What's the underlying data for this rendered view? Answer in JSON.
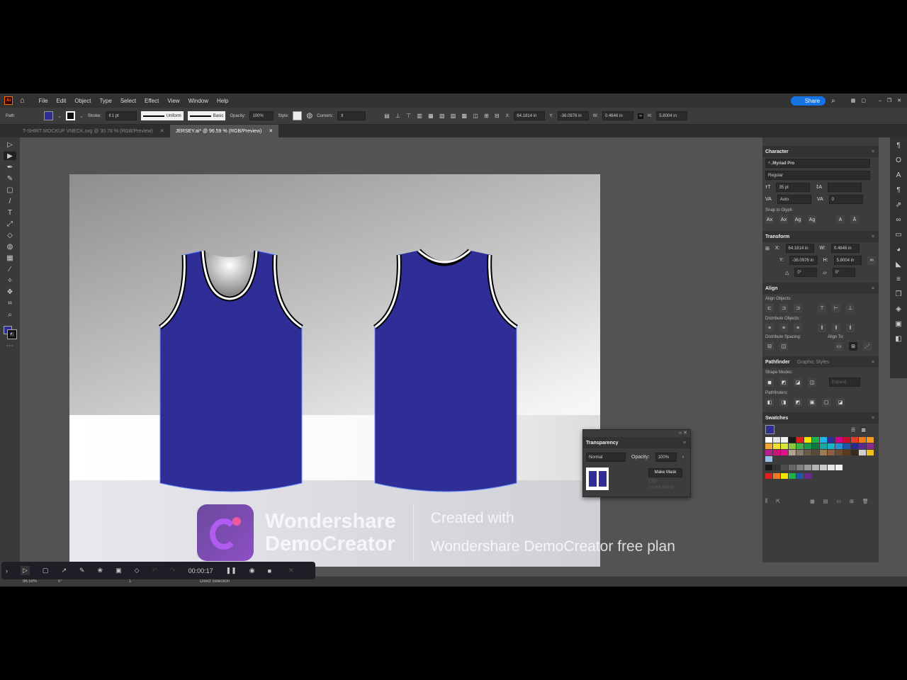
{
  "app": {
    "logo": "Ai",
    "title": "Adobe Illustrator"
  },
  "menu": [
    "File",
    "Edit",
    "Object",
    "Type",
    "Select",
    "Effect",
    "View",
    "Window",
    "Help"
  ],
  "topright": {
    "share_label": "Share"
  },
  "control": {
    "object_type": "Path",
    "fill_color": "#2e2e96",
    "stroke_label": "Stroke:",
    "stroke_weight": "1 pt",
    "profile": "Uniform",
    "brush": "Basic",
    "opacity_label": "Opacity:",
    "opacity": "100%",
    "style_label": "Style:",
    "corners_label": "Corners:",
    "x_label": "X:",
    "x": "64.1814 in",
    "y_label": "Y:",
    "y": "-36.0976 in",
    "w_label": "W:",
    "w": "0.4646 in",
    "h_label": "H:",
    "h": "5.8004 in"
  },
  "tabs": [
    {
      "label": "T-SHIRT MOCKUP VNECK.svg @ 30.78 % (RGB/Preview)",
      "active": false
    },
    {
      "label": "JERSEY.ai* @ 96.59 % (RGB/Preview)",
      "active": true
    }
  ],
  "tools": [
    "selection",
    "direct-selection",
    "pen",
    "curvature",
    "rectangle",
    "paintbrush",
    "type",
    "scale",
    "eraser",
    "shape-builder",
    "gradient",
    "eyedropper",
    "puppet-warp",
    "symbol-sprayer",
    "artboard",
    "zoom"
  ],
  "character": {
    "title": "Character",
    "font": "Myriad Pro",
    "style": "Regular",
    "size": "35 pt",
    "leading": "",
    "kerning": "Auto",
    "tracking": "0",
    "snap_label": "Snap to Glyph"
  },
  "transform": {
    "title": "Transform",
    "x": "64.1814 in",
    "y": "-36.0976 in",
    "w": "0.4646 in",
    "h": "5.8004 in",
    "rotate": "0°",
    "shear": "0°"
  },
  "align": {
    "title": "Align",
    "align_objects": "Align Objects:",
    "distribute_objects": "Distribute Objects:",
    "distribute_spacing": "Distribute Spacing:",
    "align_to": "Align To:"
  },
  "pathfinder": {
    "title": "Pathfinder",
    "tab2": "Graphic Styles",
    "shape_modes": "Shape Modes:",
    "pathfinders": "Pathfinders:",
    "expand": "Expand"
  },
  "swatches": {
    "title": "Swatches",
    "colors": [
      "#ffffff",
      "#e6e6e6",
      "#f2f2f2",
      "#1a1a1a",
      "#e0201b",
      "#f2e600",
      "#1fb14a",
      "#1fb5e6",
      "#2e2e96",
      "#d4008c",
      "#c8102e",
      "#e33c2a",
      "#f07a1e",
      "#f39c20",
      "#f0a830",
      "#f0e030",
      "#dde43a",
      "#8cc640",
      "#3db34a",
      "#189b48",
      "#0f7a3e",
      "#19a8a0",
      "#1ab0c8",
      "#2a8fd0",
      "#2455a4",
      "#2a2a8c",
      "#5a2d8c",
      "#8a2a8c",
      "#b8208a",
      "#d0107a",
      "#e0108c",
      "#b0a090",
      "#8a7a6a",
      "#6a5a4a",
      "#5a4a3a",
      "#a07a50",
      "#8a6040",
      "#6a4a30",
      "#5a3a20",
      "#3a2a1a",
      "#d0d0d0",
      "#f0c020",
      "#9ac0e8"
    ],
    "grays": [
      "#1a1a1a",
      "#333333",
      "#4d4d4d",
      "#666666",
      "#808080",
      "#999999",
      "#b3b3b3",
      "#cccccc",
      "#e6e6e6",
      "#f2f2f2"
    ],
    "brights": [
      "#e0201b",
      "#f07a1e",
      "#f2e600",
      "#1fb14a",
      "#2455a4",
      "#6a2a8c"
    ]
  },
  "transparency": {
    "title": "Transparency",
    "mode": "Normal",
    "opacity_label": "Opacity:",
    "opacity": "100%",
    "make_mask": "Make Mask",
    "clip": "Clip",
    "invert": "Invert Mask"
  },
  "status": {
    "zoom": "96.59%",
    "rotate": "0°",
    "artboard": "1",
    "tool": "Direct Selection"
  },
  "recorder": {
    "time": "00:00:17"
  },
  "watermark": {
    "brand_line1": "Wondershare",
    "brand_line2": "DemoCreator",
    "right_line1": "Created with",
    "right_line2": "Wondershare DemoCreator free plan"
  },
  "jersey_color": "#2e2e96"
}
